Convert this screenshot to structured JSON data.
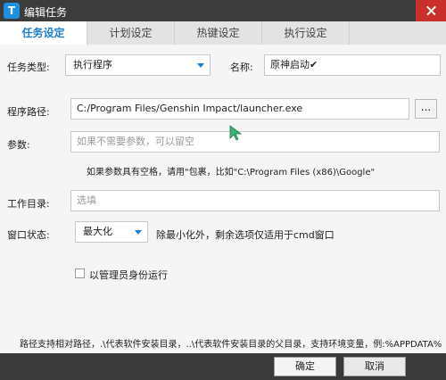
{
  "window": {
    "title": "编辑任务",
    "app_icon_letter": "T"
  },
  "tabs": [
    {
      "label": "任务设定",
      "active": true
    },
    {
      "label": "计划设定",
      "active": false
    },
    {
      "label": "热键设定",
      "active": false
    },
    {
      "label": "执行设定",
      "active": false
    }
  ],
  "form": {
    "task_type_label": "任务类型:",
    "task_type_value": "执行程序",
    "name_label": "名称:",
    "name_value": "原神启动✔",
    "path_label": "程序路径:",
    "path_value": "C:/Program Files/Genshin Impact/launcher.exe",
    "browse_label": "...",
    "params_label": "参数:",
    "params_placeholder": "如果不需要参数，可以留空",
    "params_hint": "如果参数具有空格，请用\"包裹，比如\"C:\\Program Files (x86)\\Google\"",
    "workdir_label": "工作目录:",
    "workdir_placeholder": "选填",
    "window_state_label": "窗口状态:",
    "window_state_value": "最大化",
    "window_state_hint": "除最小化外，剩余选项仅适用于cmd窗口",
    "run_as_admin_label": "以管理员身份运行",
    "run_as_admin_checked": false
  },
  "footer": {
    "path_help": "路径支持相对路径，.\\代表软件安装目录，..\\代表软件安装目录的父目录，支持环境变量，例:%APPDATA%",
    "ok_label": "确定",
    "cancel_label": "取消"
  },
  "colors": {
    "accent": "#1a7fd4",
    "titlebar": "#3c3c3c",
    "close": "#c9302c",
    "cursor": "#3cb371"
  }
}
